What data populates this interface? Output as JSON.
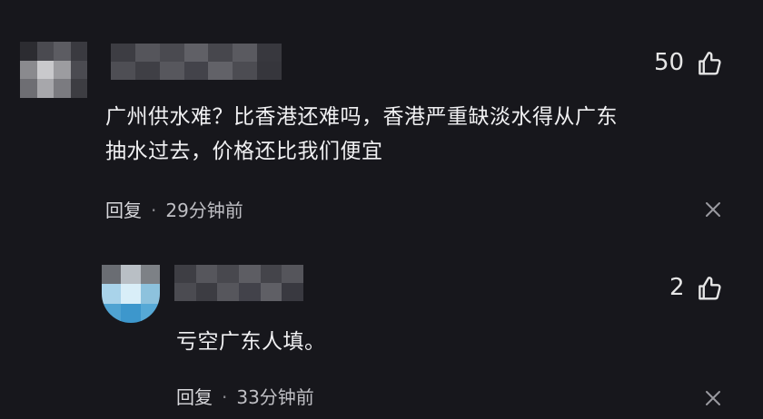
{
  "comment": {
    "likes": "50",
    "text_line1": "广州供水难？比香港还难吗，香港严重缺淡水得从广东",
    "text_line2": "抽水过去，价格还比我们便宜",
    "reply_label": "回复",
    "separator": "·",
    "time": "29分钟前"
  },
  "reply": {
    "likes": "2",
    "text": "亏空广东人填。",
    "reply_label": "回复",
    "separator": "·",
    "time": "33分钟前"
  },
  "icons": {
    "like": "thumbs-up-icon",
    "close": "close-icon"
  },
  "colors": {
    "background": "#17171c",
    "text": "#f0f0f2",
    "muted": "#bfbfc4"
  }
}
